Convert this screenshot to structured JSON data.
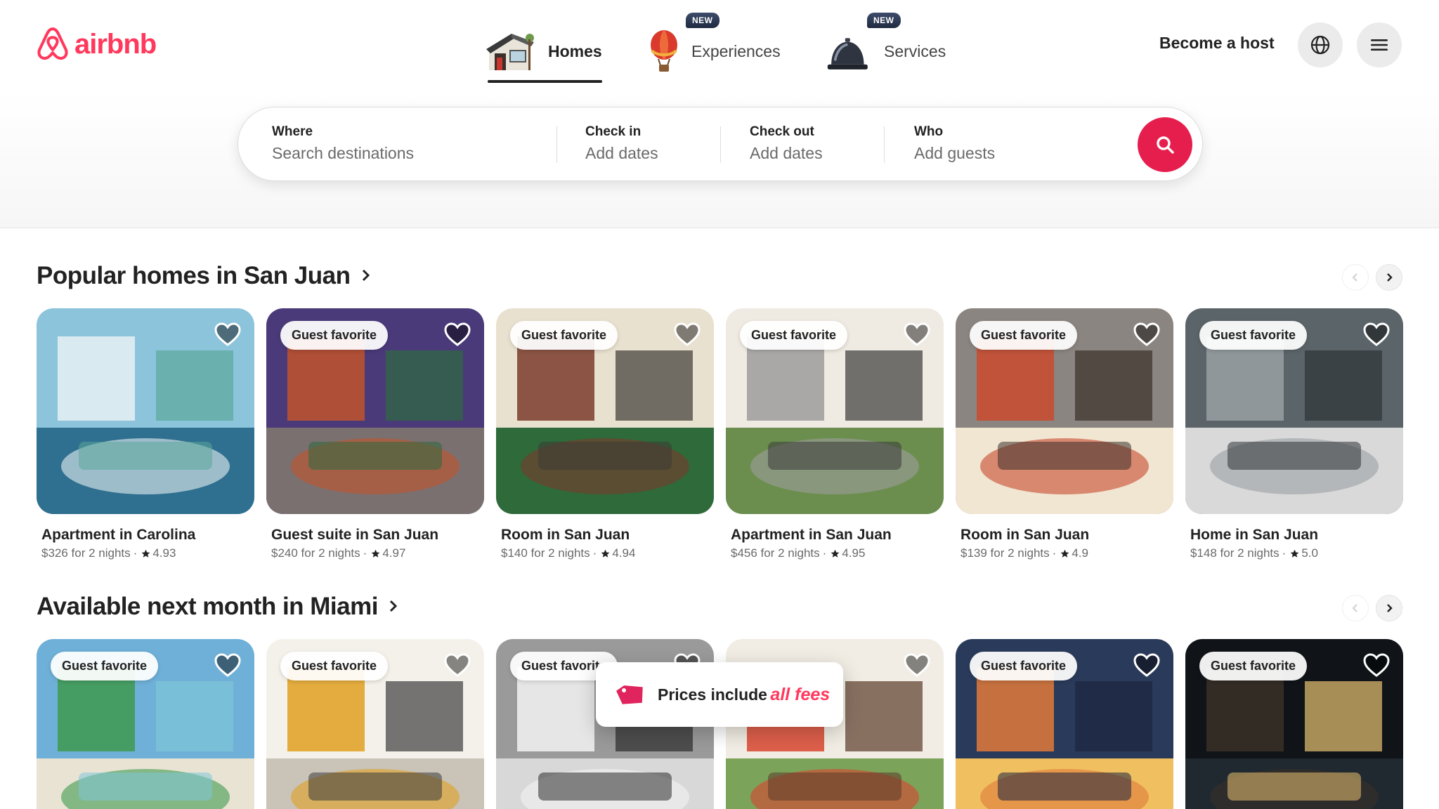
{
  "brand": {
    "name": "airbnb",
    "color": "#ff385c"
  },
  "nav": {
    "tabs": [
      {
        "label": "Homes",
        "icon": "house-icon",
        "active": true,
        "badge": ""
      },
      {
        "label": "Experiences",
        "icon": "hot-air-balloon-icon",
        "active": false,
        "badge": "NEW"
      },
      {
        "label": "Services",
        "icon": "service-bell-icon",
        "active": false,
        "badge": "NEW"
      }
    ],
    "become_host": "Become a host",
    "globe_icon": "globe-icon",
    "menu_icon": "hamburger-menu-icon"
  },
  "search": {
    "where_label": "Where",
    "where_placeholder": "Search destinations",
    "checkin_label": "Check in",
    "checkin_value": "Add dates",
    "checkout_label": "Check out",
    "checkout_value": "Add dates",
    "who_label": "Who",
    "who_value": "Add guests",
    "button_icon": "search-icon",
    "button_color": "#e61e4d"
  },
  "sections": [
    {
      "title": "Popular homes in San Juan",
      "listings": [
        {
          "badge": "",
          "title": "Apartment in Carolina",
          "price": "$326 for 2 nights",
          "rating": "4.93"
        },
        {
          "badge": "Guest favorite",
          "title": "Guest suite in San Juan",
          "price": "$240 for 2 nights",
          "rating": "4.97"
        },
        {
          "badge": "Guest favorite",
          "title": "Room in San Juan",
          "price": "$140 for 2 nights",
          "rating": "4.94"
        },
        {
          "badge": "Guest favorite",
          "title": "Apartment in San Juan",
          "price": "$456 for 2 nights",
          "rating": "4.95"
        },
        {
          "badge": "Guest favorite",
          "title": "Room in San Juan",
          "price": "$139 for 2 nights",
          "rating": "4.9"
        },
        {
          "badge": "Guest favorite",
          "title": "Home in San Juan",
          "price": "$148 for 2 nights",
          "rating": "5.0"
        }
      ]
    },
    {
      "title": "Available next month in Miami",
      "listings": [
        {
          "badge": "Guest favorite"
        },
        {
          "badge": "Guest favorite"
        },
        {
          "badge": "Guest favorite"
        },
        {
          "badge": ""
        },
        {
          "badge": "Guest favorite"
        },
        {
          "badge": "Guest favorite"
        }
      ]
    }
  ],
  "toast": {
    "prefix": "Prices include",
    "accent": "all fees",
    "icon": "price-tag-icon"
  }
}
